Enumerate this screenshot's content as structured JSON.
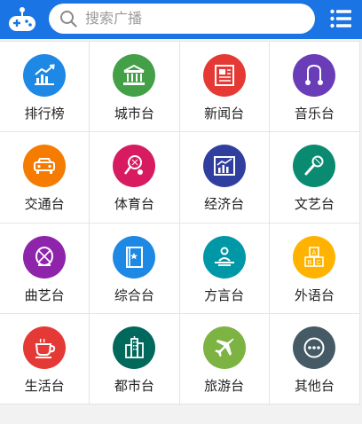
{
  "header": {
    "search_placeholder": "搜索广播",
    "brand_color": "#1b74e4",
    "logo_icon": "gamepad-logo-icon",
    "menu_icon": "list-menu-icon"
  },
  "categories": [
    {
      "label": "排行榜",
      "icon": "ranking-chart-icon",
      "color": "#1e88e5"
    },
    {
      "label": "城市台",
      "icon": "city-building-icon",
      "color": "#43a047"
    },
    {
      "label": "新闻台",
      "icon": "newspaper-icon",
      "color": "#e53935"
    },
    {
      "label": "音乐台",
      "icon": "music-icon",
      "color": "#6a3db8"
    },
    {
      "label": "交通台",
      "icon": "car-icon",
      "color": "#f57c00"
    },
    {
      "label": "体育台",
      "icon": "sports-racket-icon",
      "color": "#d81b60"
    },
    {
      "label": "经济台",
      "icon": "economy-chart-icon",
      "color": "#303f9f"
    },
    {
      "label": "文艺台",
      "icon": "microphone-icon",
      "color": "#0a8a70"
    },
    {
      "label": "曲艺台",
      "icon": "opera-mask-icon",
      "color": "#8e24aa"
    },
    {
      "label": "综合台",
      "icon": "book-icon",
      "color": "#1e88e5"
    },
    {
      "label": "方言台",
      "icon": "speaker-person-icon",
      "color": "#0097a7"
    },
    {
      "label": "外语台",
      "icon": "abc-blocks-icon",
      "color": "#ffb300"
    },
    {
      "label": "生活台",
      "icon": "coffee-cup-icon",
      "color": "#e53935"
    },
    {
      "label": "都市台",
      "icon": "skyscraper-icon",
      "color": "#00695c"
    },
    {
      "label": "旅游台",
      "icon": "airplane-icon",
      "color": "#7cb342"
    },
    {
      "label": "其他台",
      "icon": "more-dots-icon",
      "color": "#455a64"
    }
  ]
}
